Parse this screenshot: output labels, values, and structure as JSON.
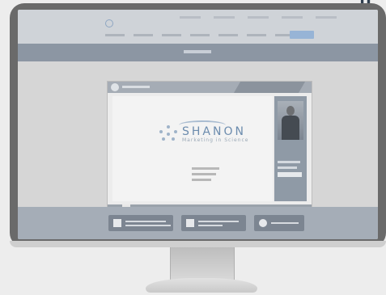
{
  "slide": {
    "brand_name": "SHANON",
    "brand_tagline": "Marketing in Science"
  },
  "colors": {
    "monitor_frame": "#6a6a6a",
    "banner": "#8c96a3",
    "action_bar": "#a5adb7",
    "brand_blue": "#6c8cae"
  },
  "icons": {
    "player_play": "play-icon",
    "download": "download-icon",
    "document": "document-icon",
    "help": "question-icon"
  }
}
